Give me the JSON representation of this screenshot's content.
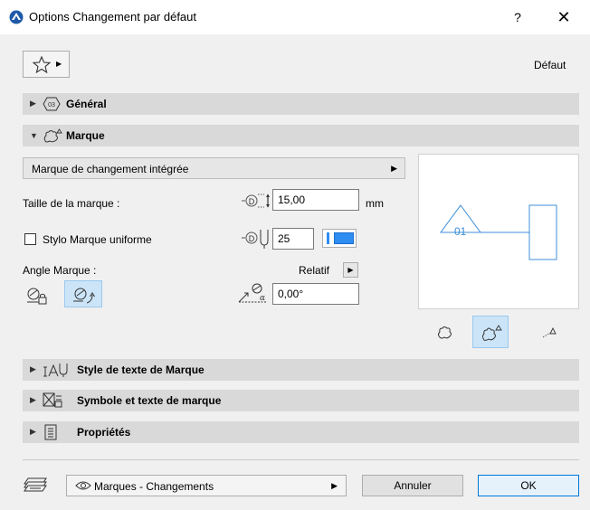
{
  "window": {
    "title": "Options Changement par défaut",
    "help": "?",
    "close": "✕"
  },
  "toolbar": {
    "default_label": "Défaut"
  },
  "sections": {
    "general": "Général",
    "marque": "Marque",
    "text_style": "Style de texte de Marque",
    "symbol_text": "Symbole et texte de marque",
    "properties": "Propriétés"
  },
  "marque": {
    "type_value": "Marque de changement intégrée",
    "size_label": "Taille de la marque :",
    "size_value": "15,00",
    "size_unit": "mm",
    "uniform_pen_label": "Stylo Marque uniforme",
    "uniform_pen_checked": false,
    "pen_value": "25",
    "angle_label": "Angle Marque :",
    "relative_label": "Relatif",
    "angle_value": "0,00°",
    "preview_text": "01"
  },
  "footer": {
    "layer_value": "Marques - Changements",
    "cancel_label": "Annuler",
    "ok_label": "OK"
  },
  "colors": {
    "accent": "#2f8cf0",
    "preview_stroke": "#3c8fd8",
    "section_bg": "#d9d9d9"
  }
}
